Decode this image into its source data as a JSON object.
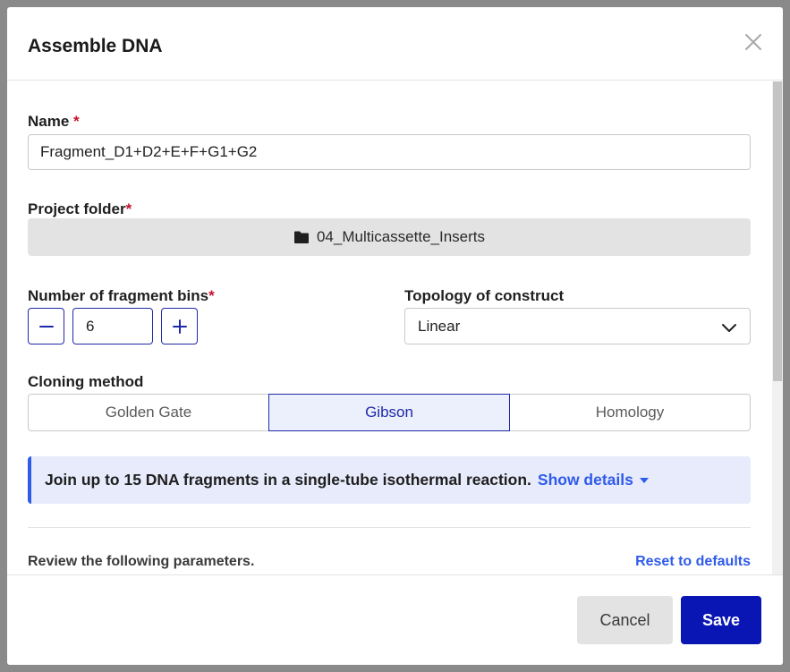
{
  "dialog": {
    "title": "Assemble DNA"
  },
  "form": {
    "name": {
      "label": "Name",
      "required_mark": "*",
      "value": "Fragment_D1+D2+E+F+G1+G2"
    },
    "project_folder": {
      "label": "Project folder",
      "required_mark": "*",
      "value": "04_Multicassette_Inserts",
      "icon": "folder-icon"
    },
    "fragment_bins": {
      "label": "Number of fragment bins",
      "required_mark": "*",
      "value": "6",
      "decrement_icon": "minus-icon",
      "increment_icon": "plus-icon"
    },
    "topology": {
      "label": "Topology of construct",
      "selected": "Linear",
      "icon": "chevron-down-icon"
    },
    "cloning_method": {
      "label": "Cloning method",
      "options": [
        "Golden Gate",
        "Gibson",
        "Homology"
      ],
      "selected": "Gibson"
    },
    "info_banner": {
      "text": "Join up to 15 DNA fragments in a single-tube isothermal reaction.",
      "link": "Show details"
    },
    "review_text": "Review the following parameters.",
    "reset_link": "Reset to defaults"
  },
  "footer": {
    "cancel_label": "Cancel",
    "save_label": "Save"
  },
  "colors": {
    "primary": "#0a16b4",
    "link": "#2f5bea",
    "required": "#c8102e",
    "info_bg": "#e7ebfb"
  }
}
